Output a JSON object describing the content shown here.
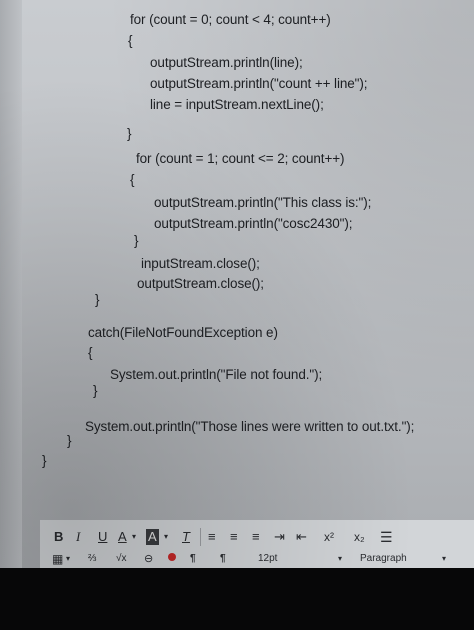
{
  "code": {
    "lines": [
      "for (count = 0; count < 4; count++)",
      "{",
      "outputStream.println(line);",
      "outputStream.println(\"count ++ line\");",
      "line = inputStream.nextLine();",
      "}",
      "for (count = 1; count <= 2; count++)",
      "{",
      "outputStream.println(\"This class is:\");",
      "outputStream.println(\"cosc2430\");",
      "}",
      "inputStream.close();",
      "outputStream.close();",
      "}",
      "catch(FileNotFoundException e)",
      "{",
      "System.out.println(\"File not found.\");",
      "}",
      "System.out.println(\"Those lines were written to out.txt.\");",
      "}",
      "}"
    ]
  },
  "toolbar": {
    "bold": "B",
    "italic": "I",
    "underline": "U",
    "font_color": "A",
    "highlight": "A",
    "clear_format": "T",
    "superscript": "x²",
    "subscript": "x₂",
    "table": "▦",
    "symbol": "⅔",
    "equation": "√x",
    "link": "⊖",
    "paragraph_mark": "¶",
    "rtl_mark": "¶",
    "font_size": "12pt",
    "paragraph_style": "Paragraph"
  },
  "colors": {
    "screen": "#c3c6ca",
    "text": "#1e2024",
    "toolbar": "#d2d5d8",
    "bezel": "#070708",
    "red_icon": "#c62828"
  }
}
